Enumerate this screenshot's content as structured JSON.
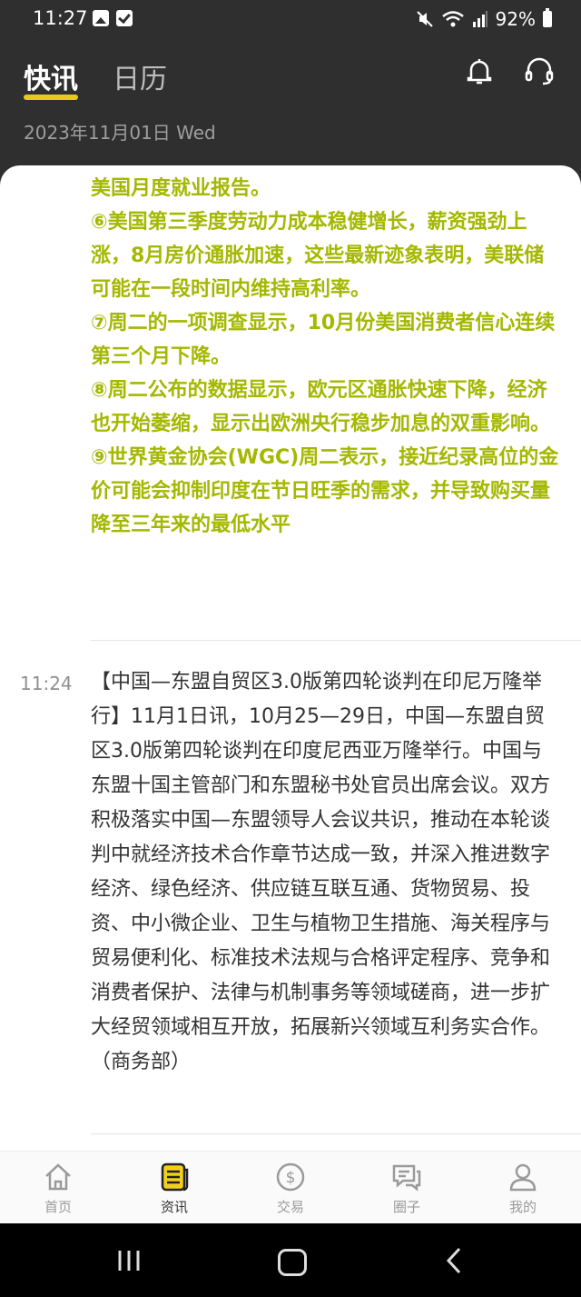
{
  "status_bar": {
    "time": "11:27",
    "battery": "92%"
  },
  "header": {
    "tabs": [
      {
        "label": "快讯"
      },
      {
        "label": "日历"
      }
    ],
    "bell_icon": "bell-icon",
    "support_icon": "headset-icon"
  },
  "date_line": "2023年11月01日 Wed",
  "highlight_news": {
    "paragraphs": [
      "储为期两天的货币政策会议的结果，以及周五公布的美国月度就业报告。",
      "⑥美国第三季度劳动力成本稳健增长，薪资强劲上涨，8月房价通胀加速，这些最新迹象表明，美联储可能在一段时间内维持高利率。",
      "⑦周二的一项调查显示，10月份美国消费者信心连续第三个月下降。",
      "⑧周二公布的数据显示，欧元区通胀快速下降，经济也开始萎缩，显示出欧洲央行稳步加息的双重影响。",
      "⑨世界黄金协会(WGC)周二表示，接近纪录高位的金价可能会抑制印度在节日旺季的需求，并导致购买量降至三年来的最低水平"
    ]
  },
  "news_item": {
    "time": "11:24",
    "body": "【中国—东盟自贸区3.0版第四轮谈判在印尼万隆举行】11月1日讯，10月25—29日，中国—东盟自贸区3.0版第四轮谈判在印度尼西亚万隆举行。中国与东盟十国主管部门和东盟秘书处官员出席会议。双方积极落实中国—东盟领导人会议共识，推动在本轮谈判中就经济技术合作章节达成一致，并深入推进数字经济、绿色经济、供应链互联互通、货物贸易、投资、中小微企业、卫生与植物卫生措施、海关程序与贸易便利化、标准技术法规与合格评定程序、竞争和消费者保护、法律与机制事务等领域磋商，进一步扩大经贸领域相互开放，拓展新兴领域互利务实合作。（商务部）"
  },
  "bottom_nav": {
    "items": [
      {
        "label": "首页",
        "icon": "home-icon"
      },
      {
        "label": "资讯",
        "icon": "news-icon"
      },
      {
        "label": "交易",
        "icon": "dollar-icon"
      },
      {
        "label": "圈子",
        "icon": "chat-icon"
      },
      {
        "label": "我的",
        "icon": "person-icon"
      }
    ]
  },
  "colors": {
    "accent": "#e8c81a",
    "highlight_text": "#a4b800",
    "header_bg": "#2f2f2f"
  }
}
